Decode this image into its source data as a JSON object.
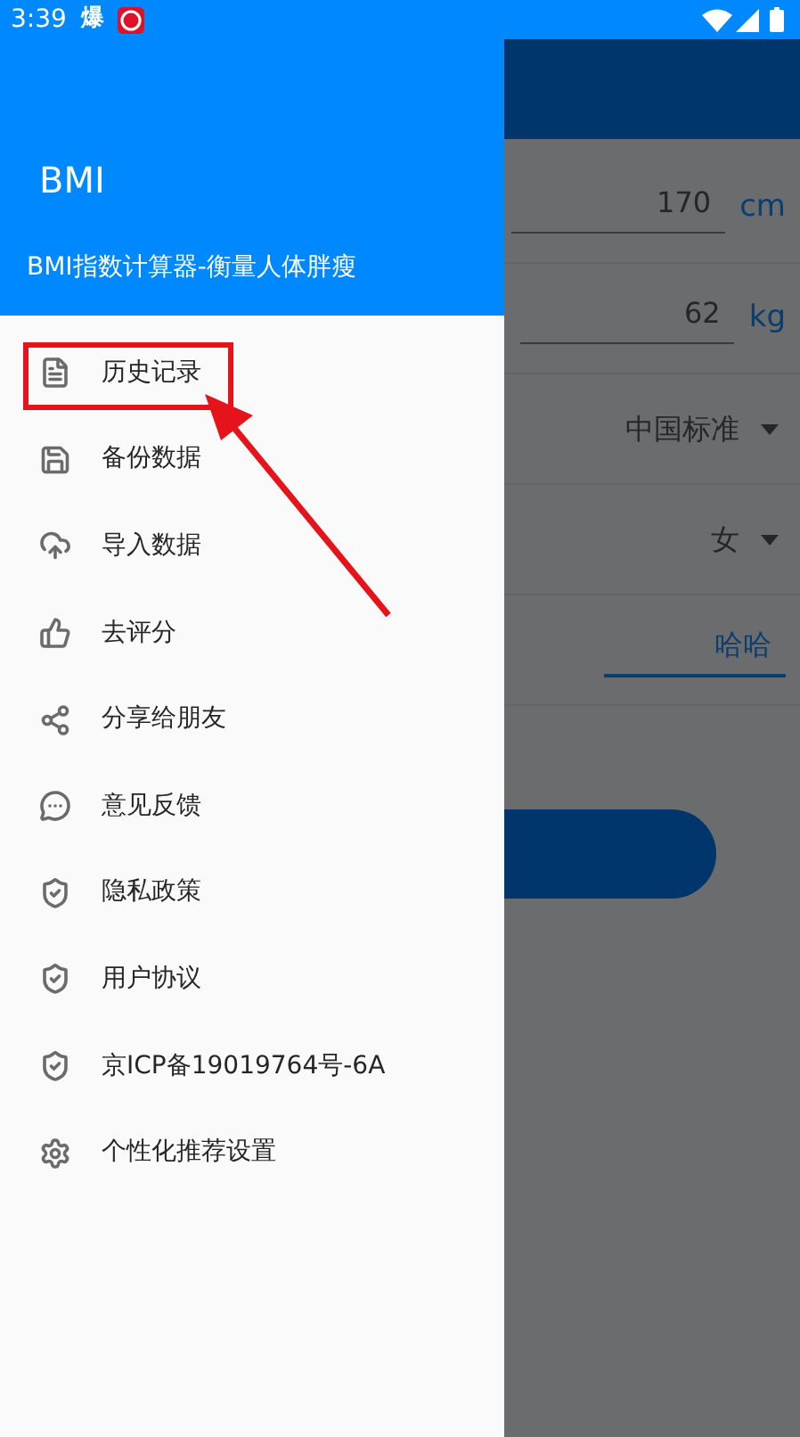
{
  "status_bar": {
    "time": "3:39",
    "notification": "爆"
  },
  "drawer": {
    "title": "BMI",
    "subtitle": "BMI指数计算器-衡量人体胖瘦",
    "items": [
      {
        "label": "历史记录",
        "kind": "history"
      },
      {
        "label": "备份数据",
        "kind": "save"
      },
      {
        "label": "导入数据",
        "kind": "upload"
      },
      {
        "label": "去评分",
        "kind": "rate"
      },
      {
        "label": "分享给朋友",
        "kind": "share"
      },
      {
        "label": "意见反馈",
        "kind": "feedback"
      },
      {
        "label": "隐私政策",
        "kind": "shield"
      },
      {
        "label": "用户协议",
        "kind": "shield"
      },
      {
        "label": "京ICP备19019764号-6A",
        "kind": "shield"
      },
      {
        "label": "个性化推荐设置",
        "kind": "settings"
      }
    ]
  },
  "background": {
    "rows": [
      {
        "kind": "input",
        "value": "170",
        "unit": "cm"
      },
      {
        "kind": "input",
        "value": "62",
        "unit": "kg"
      },
      {
        "kind": "select",
        "value": "中国标准"
      },
      {
        "kind": "select",
        "value": "女"
      },
      {
        "kind": "text",
        "value": "哈哈"
      }
    ]
  }
}
